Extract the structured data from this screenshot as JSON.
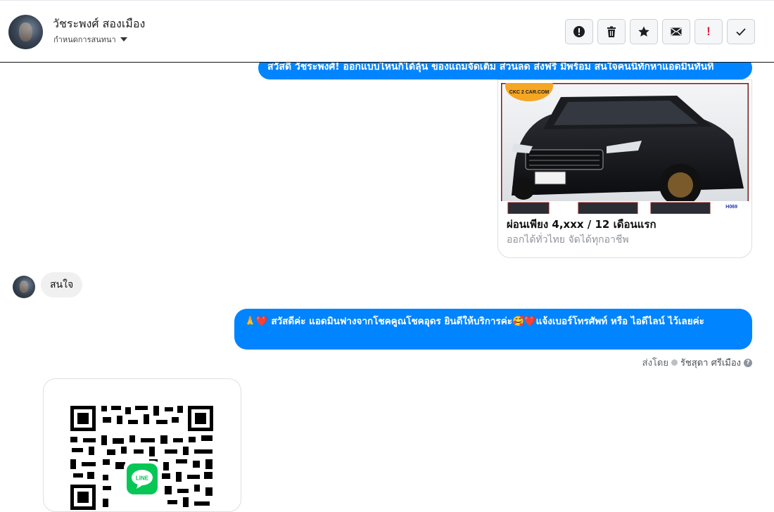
{
  "header": {
    "contact_name": "วัชระพงศ์ สองเมือง",
    "conversation_label": "กำหนดการสนทนา",
    "actions": [
      {
        "name": "alert-icon"
      },
      {
        "name": "trash-icon"
      },
      {
        "name": "star-icon"
      },
      {
        "name": "envelope-icon"
      },
      {
        "name": "exclamation-icon",
        "label": "!"
      },
      {
        "name": "check-icon"
      }
    ]
  },
  "messages": {
    "greeting": "สวัสดี วัชระพงศ์! ออกแบบไหนก็ได้ลุ้น ของแถมจัดเต็ม ส่วนลด ส่งฟรี มีพร้อม สนใจคนนี้ทักหาแอดมินทันที",
    "card": {
      "logo_text": "CKC 2 CAR.COM",
      "plate_code": "H069",
      "title": "ผ่อนเพียง 4,xxx / 12 เดือนแรก",
      "subtitle": "ออกได้ทั่วไทย จัดได้ทุกอาชีพ"
    },
    "incoming": "สนใจ",
    "reply": "🙏❤️ สวัสดีค่ะ แอดมินฟางจากโชคคูณโชคอุดร ยินดีให้บริการค่ะ🥰❤️แจ้งเบอร์โทรศัพท์ หรือ ไอดีไลน์  ไว้เลยค่ะ",
    "sent_by_label": "ส่งโดย",
    "sent_by_name": "รัชสุดา ศรีเมือง",
    "help_mark": "?",
    "qr_logo_text": "LINE"
  },
  "colors": {
    "messenger_blue": "#0084ff",
    "line_green": "#06c755",
    "incoming_bg": "#f1f0f0"
  }
}
